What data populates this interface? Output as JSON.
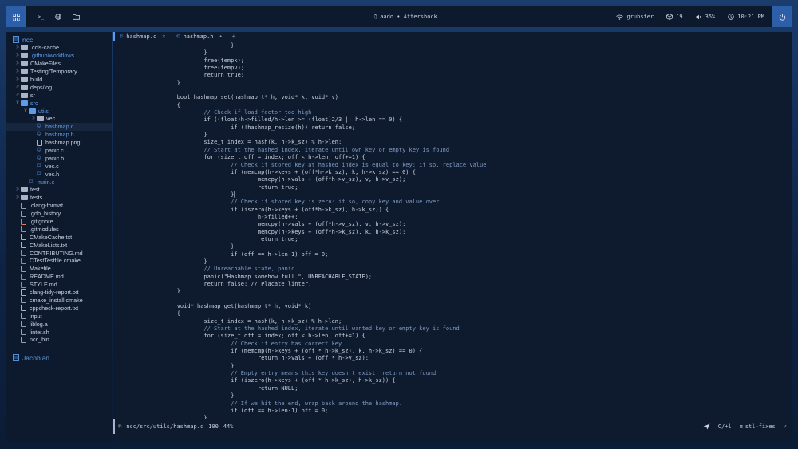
{
  "topbar": {
    "workspace_icon": "grid-icon",
    "icons": [
      "terminal-icon",
      "globe-icon",
      "folder-icon"
    ],
    "now_playing": "aado • Aftershock",
    "wifi": "grubster",
    "updates": "19",
    "volume": "35%",
    "clock": "10:21 PM"
  },
  "sidebar": {
    "project": "ncc",
    "second_project": "Jacobian",
    "tree": [
      {
        "depth": 0,
        "type": "folder",
        "chev": ">",
        "label": ".ccls-cache"
      },
      {
        "depth": 0,
        "type": "folder",
        "chev": ">",
        "label": ".github/workflows",
        "blue": true
      },
      {
        "depth": 0,
        "type": "folder",
        "chev": ">",
        "label": "CMakeFiles"
      },
      {
        "depth": 0,
        "type": "folder",
        "chev": ">",
        "label": "Testing/Temporary"
      },
      {
        "depth": 0,
        "type": "folder",
        "chev": ">",
        "label": "build"
      },
      {
        "depth": 0,
        "type": "folder",
        "chev": ">",
        "label": "deps/log"
      },
      {
        "depth": 0,
        "type": "folder",
        "chev": ">",
        "label": "sr"
      },
      {
        "depth": 0,
        "type": "folder",
        "chev": "v",
        "label": "src",
        "open": true,
        "blue": true
      },
      {
        "depth": 1,
        "type": "folder",
        "chev": "v",
        "label": "utils",
        "open": true,
        "blue": true
      },
      {
        "depth": 2,
        "type": "folder",
        "chev": ">",
        "label": "vec"
      },
      {
        "depth": 2,
        "type": "c",
        "label": "hashmap.c",
        "blue": true,
        "selected": true
      },
      {
        "depth": 2,
        "type": "h",
        "label": "hashmap.h",
        "blue": true
      },
      {
        "depth": 2,
        "type": "img",
        "label": "hashmap.png"
      },
      {
        "depth": 2,
        "type": "c",
        "label": "panic.c"
      },
      {
        "depth": 2,
        "type": "h",
        "label": "panic.h"
      },
      {
        "depth": 2,
        "type": "c",
        "label": "vec.c"
      },
      {
        "depth": 2,
        "type": "h",
        "label": "vec.h"
      },
      {
        "depth": 1,
        "type": "c",
        "label": "main.c",
        "blue": true
      },
      {
        "depth": 0,
        "type": "folder",
        "chev": ">",
        "label": "test"
      },
      {
        "depth": 0,
        "type": "folder",
        "chev": ">",
        "label": "tests"
      },
      {
        "depth": 0,
        "type": "file",
        "label": ".clang-format"
      },
      {
        "depth": 0,
        "type": "file",
        "label": ".gdb_history"
      },
      {
        "depth": 0,
        "type": "git",
        "label": ".gitignore"
      },
      {
        "depth": 0,
        "type": "git",
        "label": ".gitmodules"
      },
      {
        "depth": 0,
        "type": "doc",
        "label": "CMakeCache.txt"
      },
      {
        "depth": 0,
        "type": "doc",
        "label": "CMakeLists.txt"
      },
      {
        "depth": 0,
        "type": "md",
        "label": "CONTRIBUTING.md"
      },
      {
        "depth": 0,
        "type": "cmake",
        "label": "CTestTestfile.cmake"
      },
      {
        "depth": 0,
        "type": "file",
        "label": "Makefile"
      },
      {
        "depth": 0,
        "type": "md",
        "label": "README.md"
      },
      {
        "depth": 0,
        "type": "md",
        "label": "STYLE.md"
      },
      {
        "depth": 0,
        "type": "doc",
        "label": "clang-tidy-report.txt"
      },
      {
        "depth": 0,
        "type": "file",
        "label": "cmake_install.cmake"
      },
      {
        "depth": 0,
        "type": "doc",
        "label": "cppcheck-report.txt"
      },
      {
        "depth": 0,
        "type": "file",
        "label": "input"
      },
      {
        "depth": 0,
        "type": "file",
        "label": "liblog.a"
      },
      {
        "depth": 0,
        "type": "file",
        "label": "linter.sh"
      },
      {
        "depth": 0,
        "type": "file",
        "label": "ncc_bin"
      }
    ]
  },
  "editor": {
    "tabs": [
      {
        "label": "hashmap.c",
        "close": "×",
        "active": true
      },
      {
        "label": "hashmap.h",
        "close": "•",
        "active": false
      }
    ],
    "tab_add": "+",
    "code": [
      "                        }",
      "                }",
      "                free(tempk);",
      "                free(tempv);",
      "                return true;",
      "        }",
      "",
      "        bool hashmap_set(hashmap_t* h, void* k, void* v)",
      "        {",
      "                // Check if load factor too high",
      "                if ((float)h->filled/h->len >= (float)2/3 || h->len == 0) {",
      "                        if (!hashmap_resize(h)) return false;",
      "                }",
      "                size_t index = hash(k, h->k_sz) % h->len;",
      "                // Start at the hashed index, iterate until own key or empty key is found",
      "                for (size_t off = index; off < h->len; off+=1) {",
      "                        // Check if stored key at hashed index is equal to key: if so, replace value",
      "                        if (memcmp(h->keys + (off*h->k_sz), k, h->k_sz) == 0) {",
      "                                memcpy(h->vals + (off*h->v_sz), v, h->v_sz);",
      "                                return true;",
      "                        }▏",
      "                        // Check if stored key is zero: if so, copy key and value over",
      "                        if (iszero(h->keys + (off*h->k_sz), h->k_sz)) {",
      "                                h->filled++;",
      "                                memcpy(h->vals + (off*h->v_sz), v, h->v_sz);",
      "                                memcpy(h->keys + (off*h->k_sz), k, h->k_sz);",
      "                                return true;",
      "                        }",
      "                        if (off == h->len-1) off = 0;",
      "                }",
      "                // Unreachable state, panic",
      "                panic(\"Hashmap somehow full.\", UNREACHABLE_STATE);",
      "                return false; // Placate linter.",
      "        }",
      "",
      "        void* hashmap_get(hashmap_t* h, void* k)",
      "        {",
      "                size_t index = hash(k, h->k_sz) % h->len;",
      "                // Start at the hashed index, iterate until wanted key or empty key is found",
      "                for (size_t off = index; off < h->len; off+=1) {",
      "                        // Check if entry has correct key",
      "                        if (memcmp(h->keys + (off * h->k_sz), k, h->k_sz) == 0) {",
      "                                return h->vals + (off * h->v_sz);",
      "                        }",
      "                        // Empty entry means this key doesn't exist: return not found",
      "                        if (iszero(h->keys + (off * h->k_sz), h->k_sz)) {",
      "                                return NULL;",
      "                        }",
      "                        // If we hit the end, wrap back around the hashmap.",
      "                        if (off == h->len-1) off = 0;",
      "                }"
    ],
    "status": {
      "path": "ncc/src/utils/hashmap.c",
      "position": "100",
      "percent": "44%",
      "encoding": "C/+l",
      "branch": "stl-fixes"
    }
  },
  "colors": {
    "accent": "#2c5fa8",
    "link": "#5d9ce8",
    "panel": "#0d1a2e"
  }
}
